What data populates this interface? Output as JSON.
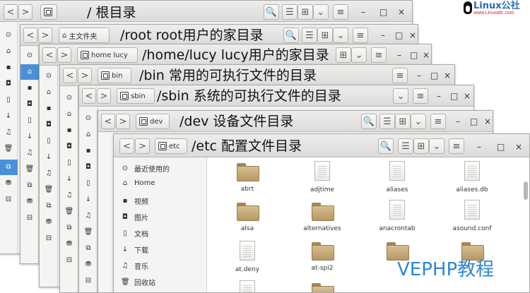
{
  "logo": {
    "text": "Linux公社",
    "url_text": "www.Linuxidc.com"
  },
  "watermark": "VEPHP教程",
  "windows": [
    {
      "title": "/  根目录"
    },
    {
      "title": "/root  root用户的家目录",
      "path_segments": [
        "主文件夹"
      ]
    },
    {
      "title": "/home/lucy  lucy用户的家目录",
      "path_segments": [
        "home",
        "lucy"
      ]
    },
    {
      "title": "/bin  常用的可执行文件的目录",
      "path_segments": [
        "bin"
      ]
    },
    {
      "title": "/sbin  系统的可执行文件的目录",
      "path_segments": [
        "sbin"
      ]
    },
    {
      "title": "/dev  设备文件目录",
      "path_segments": [
        "dev"
      ]
    },
    {
      "title": "/etc  配置文件目录",
      "path_segments": [
        "etc"
      ]
    }
  ],
  "nav": {
    "back": "<",
    "forward": ">"
  },
  "toolbar": {
    "search": "🔍",
    "list": "☰",
    "grid": "⊞",
    "dropdown": "⌄",
    "menu": "≡"
  },
  "window_controls": {
    "minimize": "–",
    "maximize": "□",
    "close": "×"
  },
  "side_icons": [
    "⊙",
    "⌂",
    "▪",
    "◘",
    "▯",
    "↓",
    "♫",
    "🗑",
    "⧉",
    "⛃",
    "⊟"
  ],
  "sidebar": [
    {
      "icon": "⊙",
      "label": "最近使用的"
    },
    {
      "icon": "⌂",
      "label": "Home"
    },
    {
      "icon": "▪",
      "label": "视频"
    },
    {
      "icon": "◘",
      "label": "图片"
    },
    {
      "icon": "▯",
      "label": "文档"
    },
    {
      "icon": "↓",
      "label": "下载"
    },
    {
      "icon": "♫",
      "label": "音乐"
    },
    {
      "icon": "🗑",
      "label": "回收站"
    }
  ],
  "files": [
    {
      "name": "abrt",
      "kind": "folder"
    },
    {
      "name": "adjtime",
      "kind": "doc"
    },
    {
      "name": "aliases",
      "kind": "doc"
    },
    {
      "name": "aliases.db",
      "kind": "doc"
    },
    {
      "name": "alsa",
      "kind": "folder"
    },
    {
      "name": "alternatives",
      "kind": "folder"
    },
    {
      "name": "anacrontab",
      "kind": "doc"
    },
    {
      "name": "asound.conf",
      "kind": "doc"
    },
    {
      "name": "at.deny",
      "kind": "doc"
    },
    {
      "name": "at-spi2",
      "kind": "folder"
    },
    {
      "name": "",
      "kind": "folder"
    },
    {
      "name": "",
      "kind": "folder"
    },
    {
      "name": "",
      "kind": "doc"
    },
    {
      "name": "",
      "kind": "folder"
    }
  ]
}
